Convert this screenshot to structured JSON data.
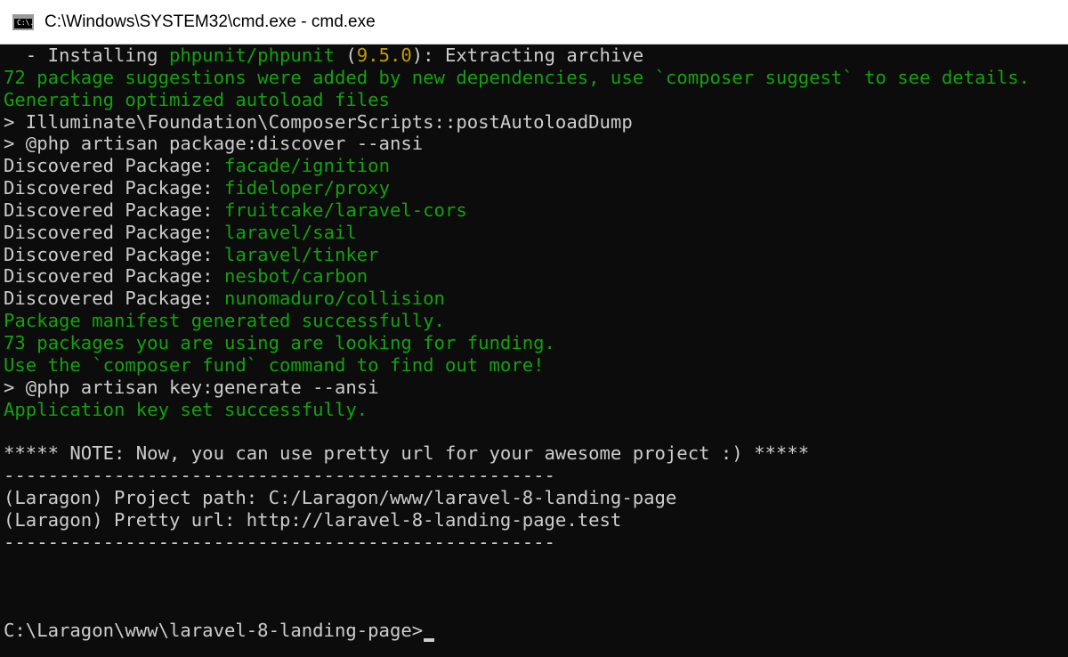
{
  "window": {
    "title": "C:\\Windows\\SYSTEM32\\cmd.exe - cmd.exe",
    "icon": "cmd-console-icon",
    "icon_text": "C:\\."
  },
  "colors": {
    "background": "#0c0c0c",
    "text": "#cccccc",
    "green": "#13a10e",
    "yellow": "#c19c00"
  },
  "console": {
    "installing": {
      "prefix": "  - Installing ",
      "package": "phpunit/phpunit",
      "open": " (",
      "version": "9.5.0",
      "suffix": "): Extracting archive"
    },
    "suggestions": "72 package suggestions were added by new dependencies, use `composer suggest` to see details.",
    "autoload": "Generating optimized autoload files",
    "post_dump": "> Illuminate\\Foundation\\ComposerScripts::postAutoloadDump",
    "discover_cmd": "> @php artisan package:discover --ansi",
    "discovered_label": "Discovered Package: ",
    "discovered_packages": [
      "facade/ignition",
      "fideloper/proxy",
      "fruitcake/laravel-cors",
      "laravel/sail",
      "laravel/tinker",
      "nesbot/carbon",
      "nunomaduro/collision"
    ],
    "manifest": "Package manifest generated successfully.",
    "funding": "73 packages you are using are looking for funding.",
    "fund_hint": "Use the `composer fund` command to find out more!",
    "key_cmd": "> @php artisan key:generate --ansi",
    "key_done": "Application key set successfully.",
    "note": "***** NOTE: Now, you can use pretty url for your awesome project :) *****",
    "divider": "--------------------------------------------------",
    "project_path": "(Laragon) Project path: C:/Laragon/www/laravel-8-landing-page",
    "pretty_url": "(Laragon) Pretty url: http://laravel-8-landing-page.test",
    "prompt": "C:\\Laragon\\www\\laravel-8-landing-page>"
  }
}
